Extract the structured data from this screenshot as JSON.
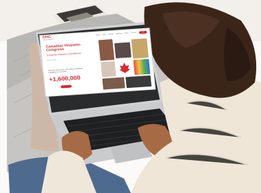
{
  "site": {
    "logo": "GHC",
    "logo_sub": "Global Hispanic",
    "menu": [
      "Home",
      "About",
      "Events",
      "Members",
      "News",
      "Contact"
    ],
    "nav_button": "Join",
    "hero_title": "Canadian Hispanic Congress",
    "hero_subtitle": "Congreso Hispano Canadiense",
    "hero_note": "Bienvenidos",
    "hero_description": "We are more than one million Hispanic residents in Canada",
    "hero_stat": "+1,600,000",
    "hero_cta": ""
  },
  "colors": {
    "brand": "#d9262f"
  }
}
